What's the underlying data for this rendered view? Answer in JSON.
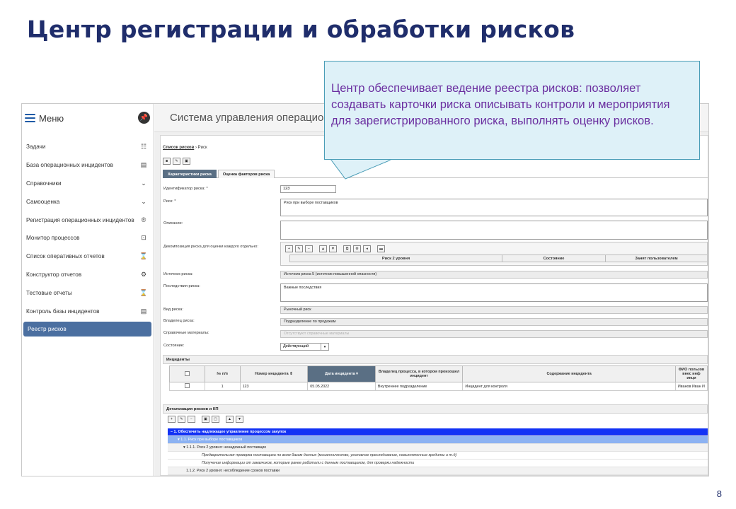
{
  "slide": {
    "title": "Центр регистрации и обработки рисков",
    "page_number": "8",
    "callout_text": "Центр обеспечивает ведение реестра рисков: позволяет создавать карточки риска  описывать контроли и мероприятия для зарегистрированного риска, выполнять оценку рисков."
  },
  "sidebar": {
    "menu_label": "Меню",
    "pin_icon": "pin-icon",
    "items": [
      {
        "label": "Задачи",
        "icon": "☷"
      },
      {
        "label": "База операционных инцидентов",
        "icon": "▤"
      },
      {
        "label": "Справочники",
        "icon": "⌄"
      },
      {
        "label": "Самооценка",
        "icon": "⌄"
      },
      {
        "label": "Регистрация операционных инцидентов",
        "icon": "®"
      },
      {
        "label": "Монитор процессов",
        "icon": "⊡"
      },
      {
        "label": "Список оперативных отчетов",
        "icon": "⌛"
      },
      {
        "label": "Конструктор отчетов",
        "icon": "⚙"
      },
      {
        "label": "Тестовые отчеты",
        "icon": "⌛"
      },
      {
        "label": "Контроль базы инцидентов",
        "icon": "▤"
      },
      {
        "label": "Реестр рисков",
        "icon": ""
      }
    ],
    "active_color": "#4b6fa0"
  },
  "app": {
    "title": "Система управления операционным р",
    "breadcrumb_link": "Список рисков",
    "breadcrumb_current": "Риск",
    "tabs": [
      "Характеристики риска",
      "Оценка факторов риска"
    ],
    "form": {
      "id_label": "Идентификатор риска: *",
      "id_value": "123",
      "risk_label": "Риск: *",
      "risk_value": "Риск при выборе поставщиков",
      "description_label": "Описание:",
      "description_value": "",
      "decomposition_label": "Декомпозиция риска для оценки каждого отдельно:",
      "decomposition_columns": [
        "Риск 2 уровня",
        "Состояние",
        "Занят пользователем"
      ],
      "source_label": "Источник риска:",
      "source_value": "Источник риска 5 (источник повышенной опасности)",
      "consequences_label": "Последствия риска:",
      "consequences_value": "Важные последствия",
      "type_label": "Вид риска:",
      "type_value": "Рыночный риск",
      "owner_label": "Владелец риска:",
      "owner_value": "Подразделение по продажам",
      "reference_label": "Справочные материалы:",
      "reference_placeholder": "Отсутствуют справочные материалы",
      "status_label": "Состояние:",
      "status_value": "Действующий"
    },
    "incidents": {
      "section_title": "Инциденты",
      "columns": [
        "№ п/п",
        "Номер инцидента ⇕",
        "Дата инцидента ▾",
        "Владелец процесса, в котором произошел инцидент",
        "Содержание инцидента",
        "ФИО пользов внес инф инци"
      ],
      "rows": [
        {
          "n": "1",
          "number": "123",
          "date": "05.05.2022",
          "owner": "Внутреннее подразделение",
          "content": "Инцидент для контроля",
          "user": "Иванов Иван И"
        }
      ]
    },
    "detail": {
      "section_title": "Детализация рисков и КП",
      "tree": [
        {
          "level": "lvl0",
          "text": "– 1. Обеспечить надлежащее управление процессом закупок"
        },
        {
          "level": "lvl1",
          "text": "▾ 1.1. Риск при выборе поставщиков"
        },
        {
          "level": "lvl2",
          "text": "▾ 1.1.1. Риск 2 уровня: ненадежный поставщик"
        },
        {
          "level": "item",
          "text": "Предварительная проверка поставщика по всем базам данных (мошенничество, уголовное преследование, невыплаченные кредиты и т.д)"
        },
        {
          "level": "item",
          "text": "Получение информации от заказчиков, которые ранее работали с данным поставщиком, для проверки надежности"
        },
        {
          "level": "lvl2",
          "text": "1.1.2. Риск 2 уровня: несоблюдение сроков поставки"
        }
      ]
    }
  }
}
